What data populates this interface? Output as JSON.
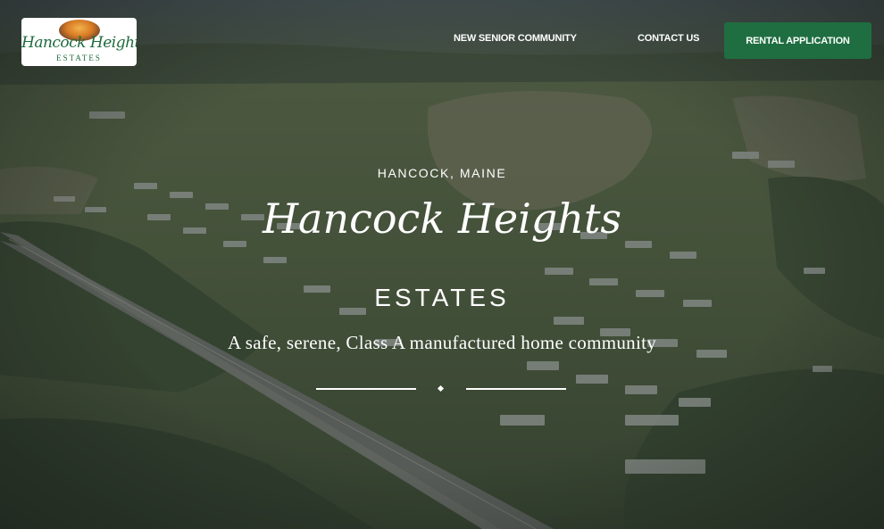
{
  "header": {
    "logo": {
      "script_text": "Hancock Heights",
      "sub_text": "ESTATES"
    },
    "nav": {
      "senior_label": "NEW SENIOR COMMUNITY",
      "contact_label": "CONTACT US",
      "cta_label": "RENTAL APPLICATION"
    }
  },
  "hero": {
    "eyebrow": "HANCOCK, MAINE",
    "script_title": "Hancock Heights",
    "subtitle": "ESTATES",
    "tagline": "A safe, serene, Class A manufactured home community"
  },
  "colors": {
    "brand_green": "#1f6e41",
    "logo_green": "#1d6b3c",
    "overlay": "#28302c",
    "text": "#ffffff"
  }
}
